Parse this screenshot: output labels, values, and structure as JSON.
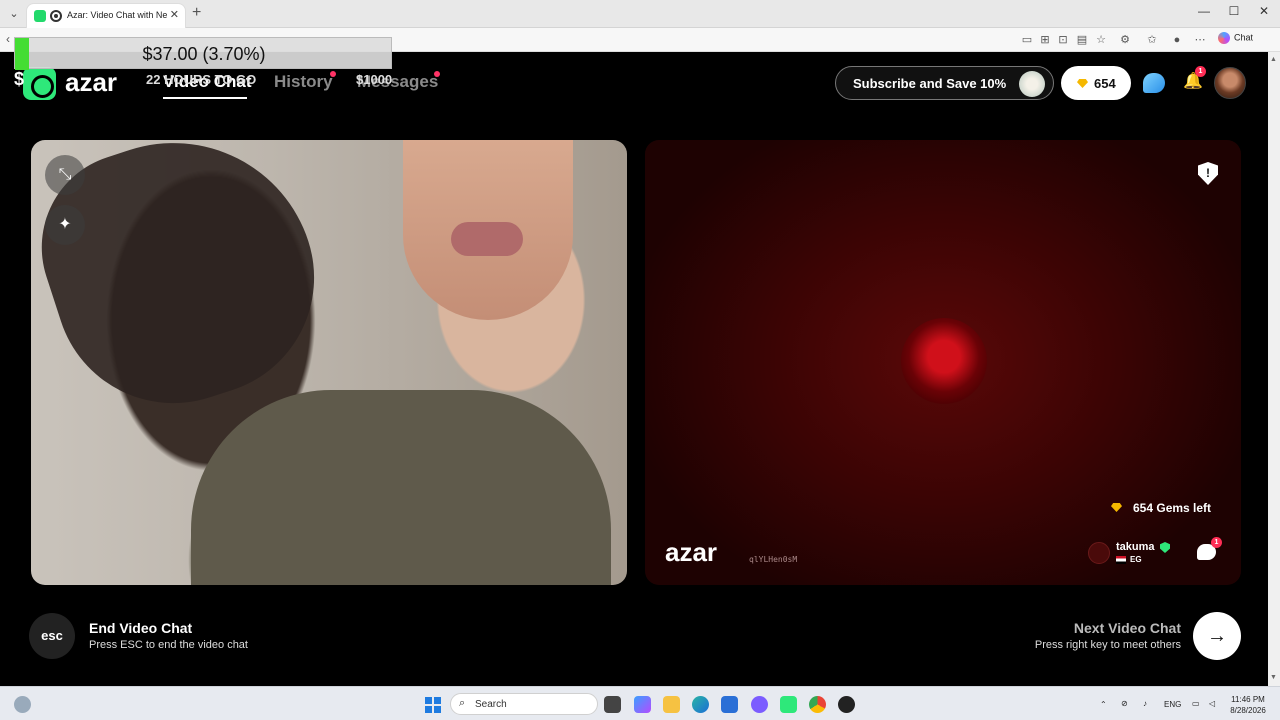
{
  "browser": {
    "tab_title": "Azar: Video Chat with New Pe",
    "tab_close": "✕",
    "new_tab": "+",
    "chat_button": "Chat",
    "minimize": "—",
    "maximize": "☐",
    "close": "✕"
  },
  "stream_overlay": {
    "amount": "$37.00 (3.70%)",
    "dollar": "$",
    "hours_text": "22 HOURS TO GO",
    "goal": "$1000"
  },
  "header": {
    "brand": "azar",
    "nav": [
      {
        "label": "Video Chat",
        "active": true
      },
      {
        "label": "History",
        "active": false
      },
      {
        "label": "Messages",
        "active": false
      }
    ],
    "subscribe_label": "Subscribe and Save 10%",
    "gems": "654",
    "bell_badge": "1"
  },
  "video": {
    "gems_left": "654 Gems left",
    "watermark": "azar",
    "watermark_id": "qlYLHen0sM",
    "partner_name": "takuma",
    "partner_country": "EG",
    "msg_badge": "1"
  },
  "controls": {
    "esc_label": "esc",
    "end_title": "End Video Chat",
    "end_sub": "Press ESC to end the video chat",
    "next_title": "Next Video Chat",
    "next_sub": "Press right key to meet others",
    "next_arrow": "→"
  },
  "taskbar": {
    "search": "Search",
    "lang": "ENG",
    "time": "11:46 PM",
    "date": "8/28/2026"
  },
  "colors": {
    "accent": "#2ee87a",
    "alert": "#ff2d55",
    "gem": "#f5b800"
  }
}
